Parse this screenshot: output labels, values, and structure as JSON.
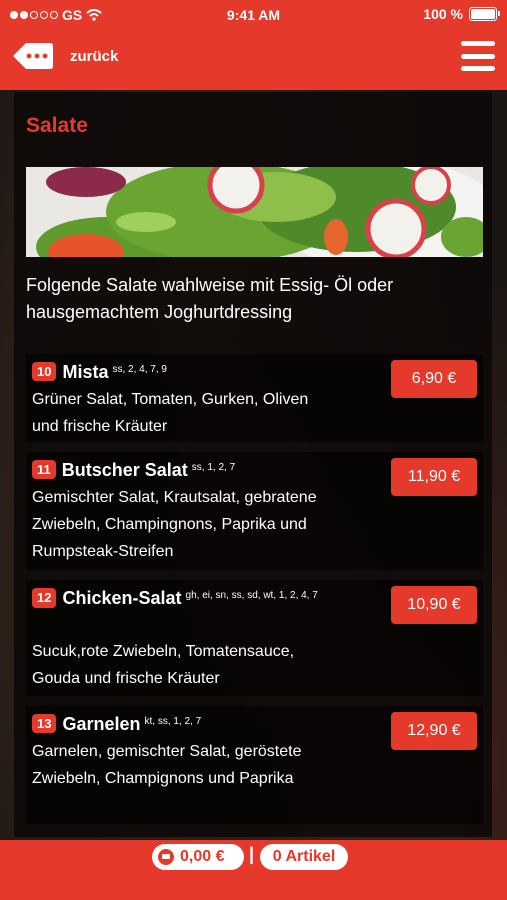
{
  "status_bar": {
    "carrier": "GS",
    "time": "9:41 AM",
    "battery": "100 %"
  },
  "nav": {
    "back_label": "zurück"
  },
  "section": {
    "title": "Salate",
    "intro": "Folgende Salate wahlweise mit Essig- Öl oder hausgemachtem Joghurtdressing"
  },
  "items": [
    {
      "number": "10",
      "name": "Mista",
      "allergens": "ss, 2, 4, 7, 9",
      "description": "Grüner Salat, Tomaten, Gurken, Oliven und frische Kräuter",
      "price": "6,90 €"
    },
    {
      "number": "11",
      "name": "Butscher Salat",
      "allergens": "ss, 1, 2, 7",
      "description": "Gemischter Salat, Krautsalat, gebratene Zwiebeln, Champingnons, Paprika und Rumpsteak-Streifen",
      "price": "11,90 €"
    },
    {
      "number": "12",
      "name": "Chicken-Salat",
      "allergens": "gh, ei, sn, ss, sd, wt, 1, 2, 4, 7",
      "description": "Sucuk,rote Zwiebeln, Tomatensauce, Gouda und frische Kräuter",
      "price": "10,90 €"
    },
    {
      "number": "13",
      "name": "Garnelen",
      "allergens": "kt, ss, 1, 2, 7",
      "description": "Garnelen, gemischter Salat, geröstete Zwiebeln, Champignons und Paprika",
      "price": "12,90 €"
    }
  ],
  "cart": {
    "total": "0,00 €",
    "separator": "|",
    "articles": "0 Artikel"
  }
}
